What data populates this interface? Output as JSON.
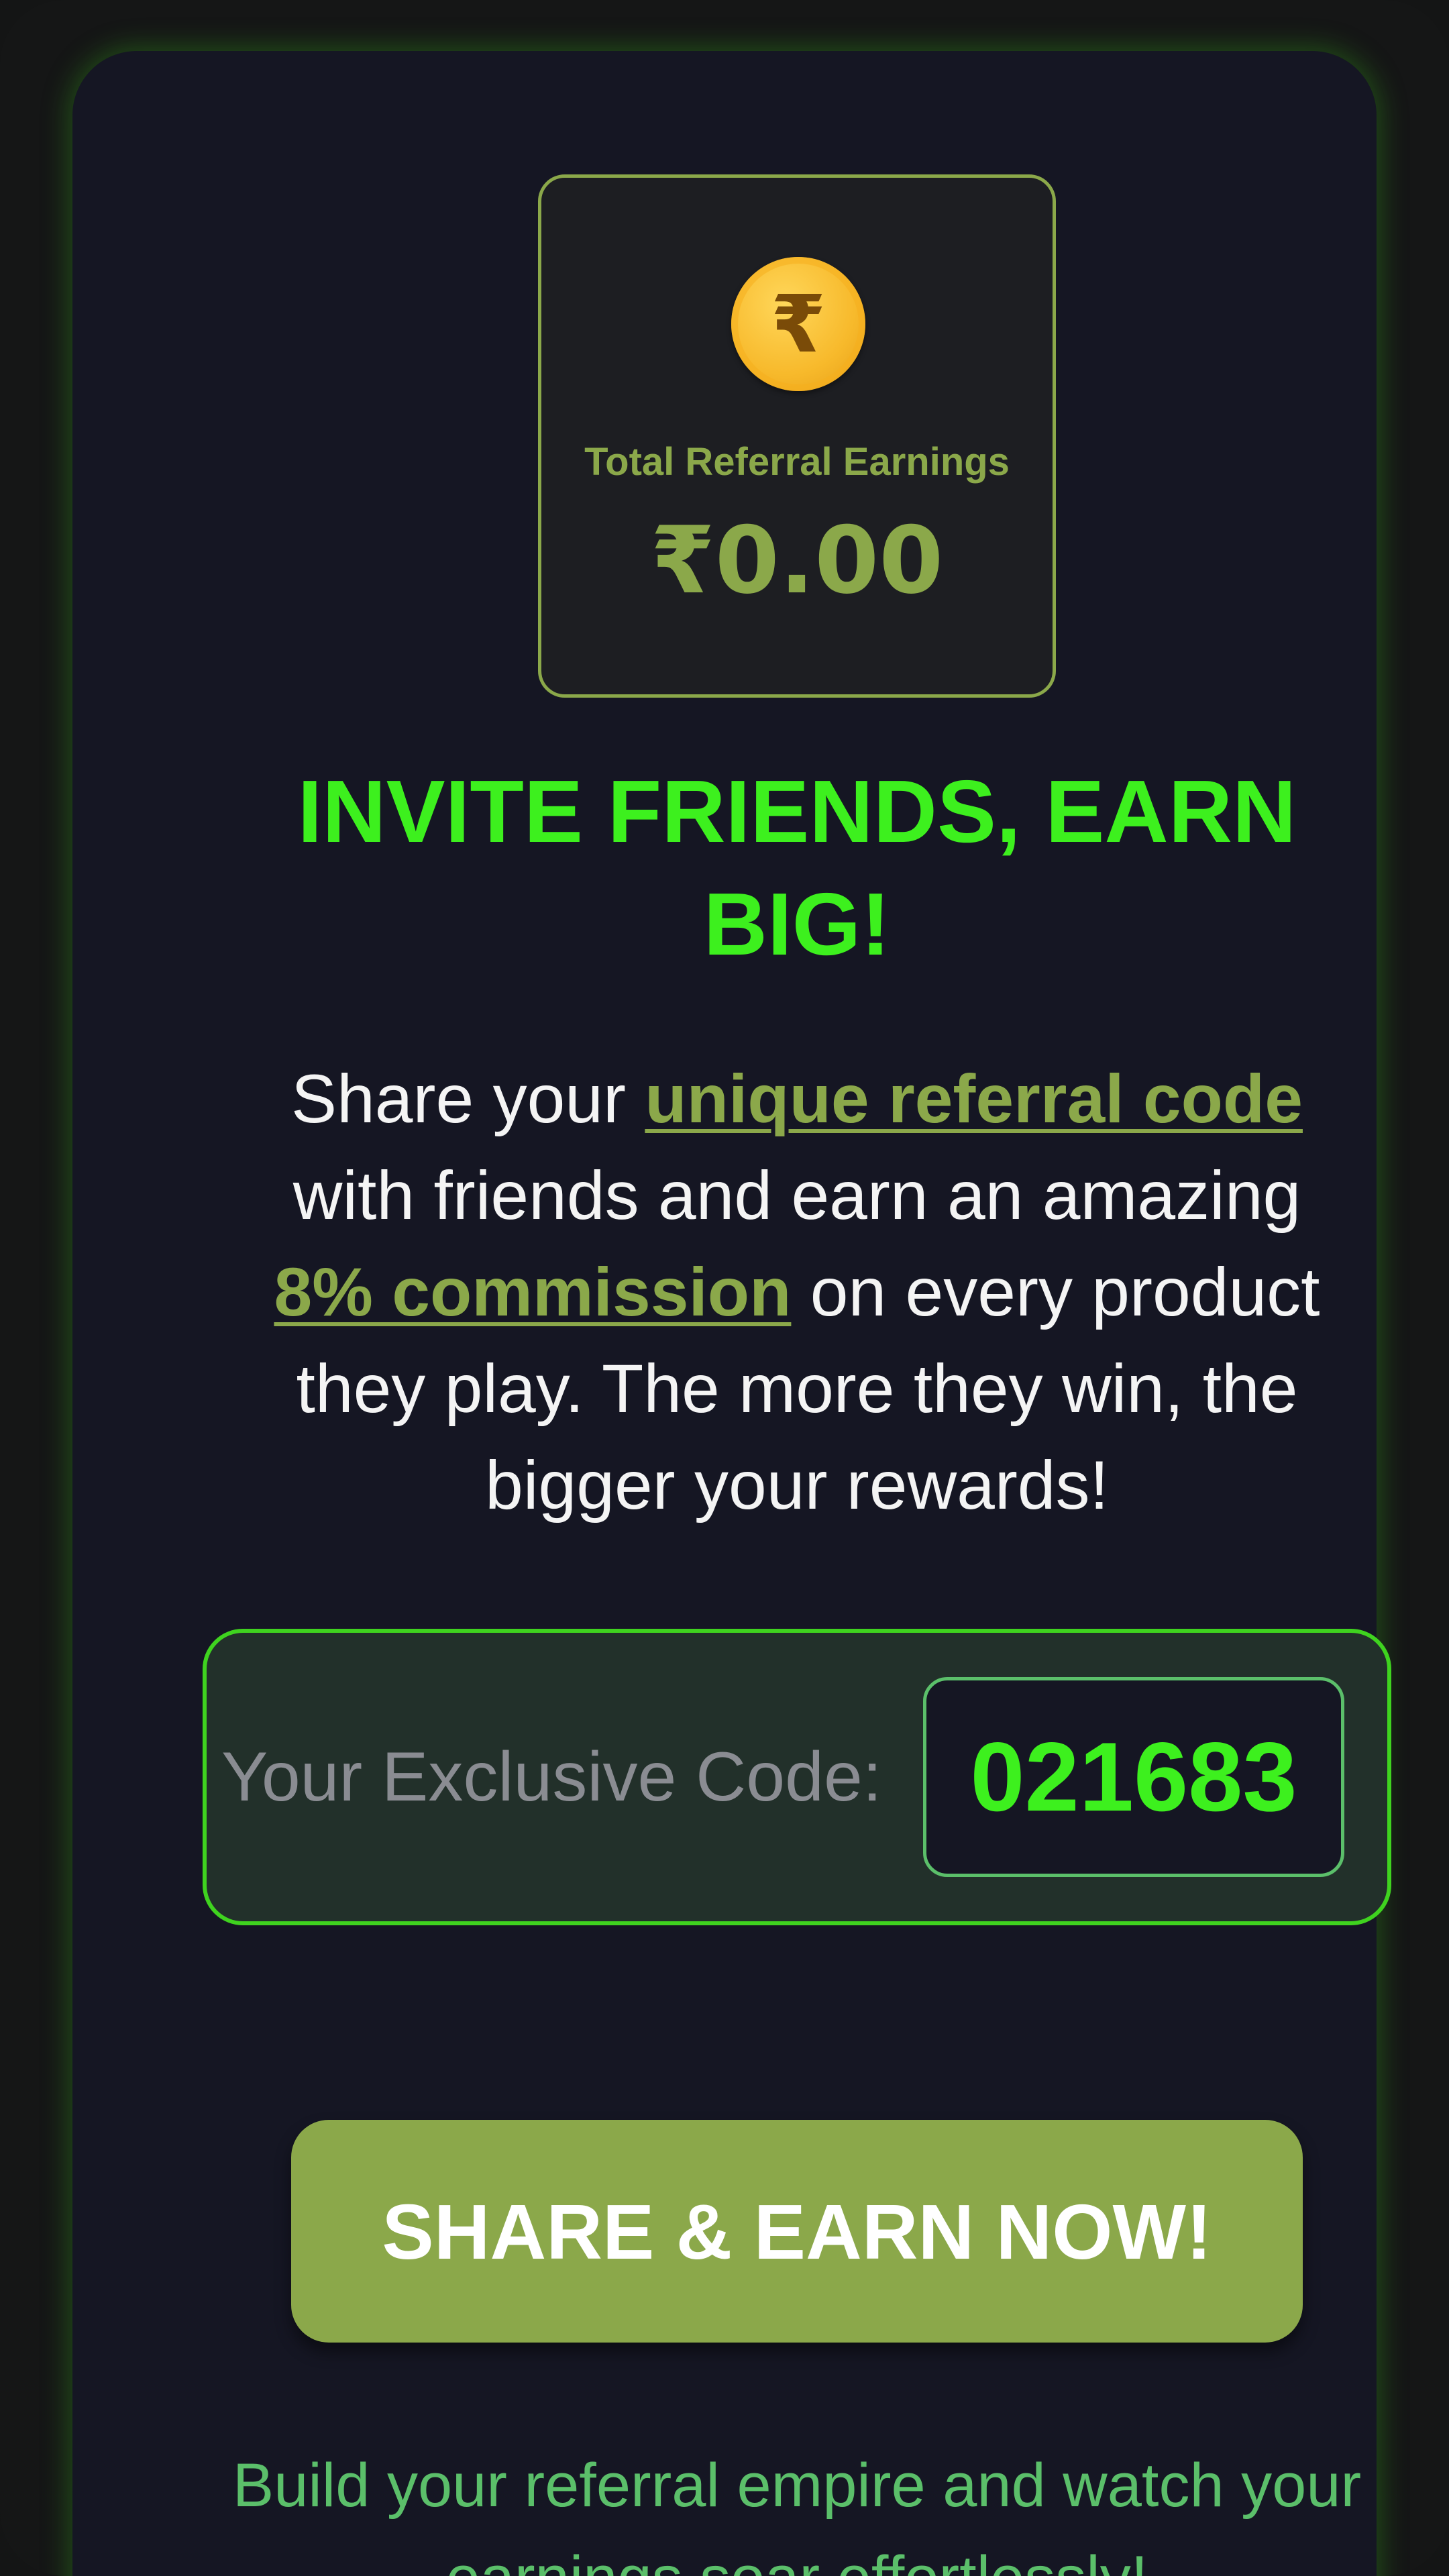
{
  "earnings": {
    "icon": "rupee-coin-icon",
    "currency_symbol": "₹",
    "label": "Total Referral Earnings",
    "value": "₹0.00"
  },
  "headline": "INVITE FRIENDS, EARN BIG!",
  "description": {
    "part1": "Share your ",
    "highlight1": "unique referral code",
    "part2": " with friends and earn an amazing ",
    "highlight2": "8% commission",
    "part3": " on every product they play. The more they win, the bigger your rewards!"
  },
  "code": {
    "label": "Your Exclusive Code:",
    "value": "021683"
  },
  "share_button": {
    "label": "SHARE & EARN NOW!"
  },
  "footer": "Build your referral empire and watch your earnings soar effortlessly!",
  "colors": {
    "accent": "#8ba84a",
    "neon_green": "#3df01e",
    "background": "#151623"
  }
}
